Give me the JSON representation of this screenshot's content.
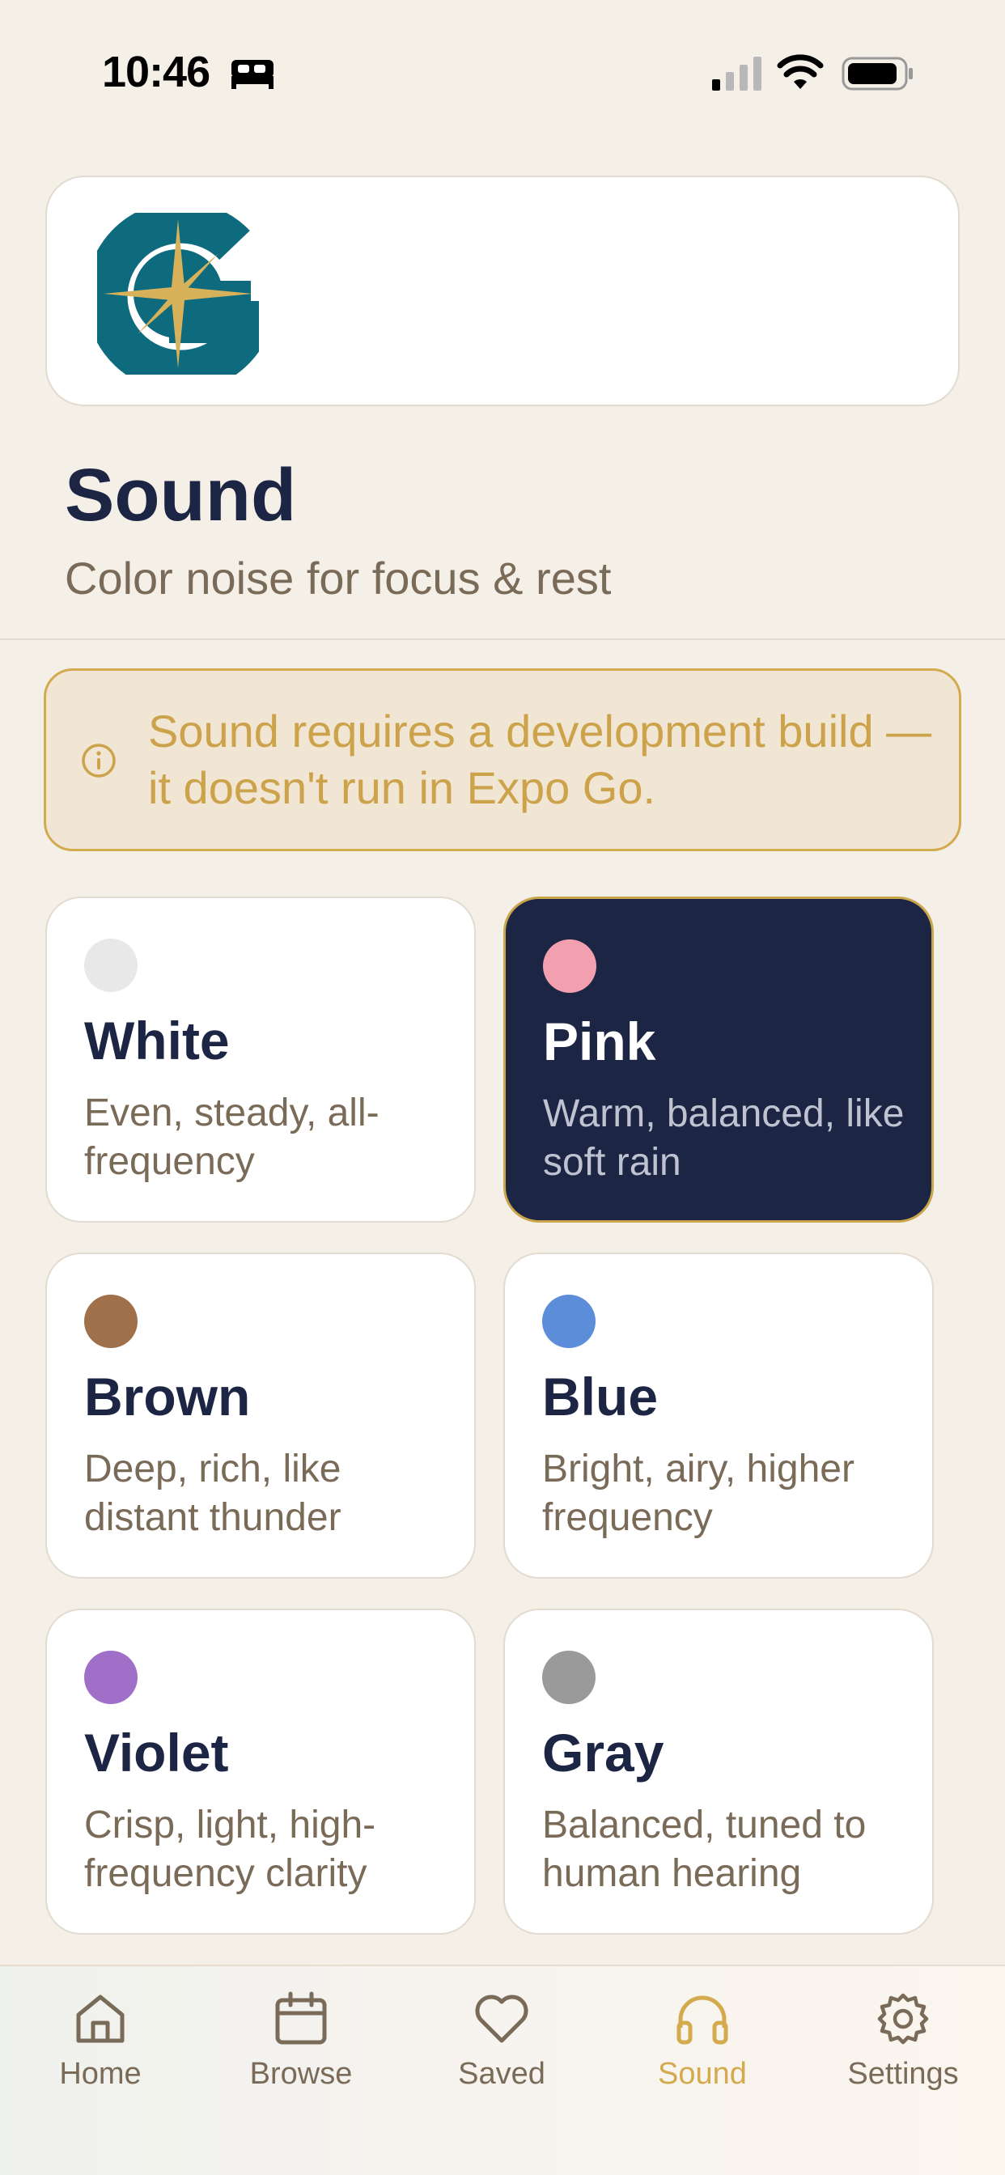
{
  "status_bar": {
    "time": "10:46"
  },
  "header": {
    "title": "Sound",
    "subtitle": "Color noise for focus & rest"
  },
  "notice": {
    "text": "Sound requires a development build — it doesn't run in Expo Go.",
    "icon": "info-icon"
  },
  "noise_options": [
    {
      "name": "White",
      "description": "Even, steady, all-frequency",
      "color": "#E8E8E8",
      "selected": false
    },
    {
      "name": "Pink",
      "description": "Warm, balanced, like soft rain",
      "color": "#F2A0B0",
      "selected": true
    },
    {
      "name": "Brown",
      "description": "Deep, rich, like distant thunder",
      "color": "#A0704A",
      "selected": false
    },
    {
      "name": "Blue",
      "description": "Bright, airy, higher frequency",
      "color": "#5B8DD9",
      "selected": false
    },
    {
      "name": "Violet",
      "description": "Crisp, light, high-frequency clarity",
      "color": "#A070C8",
      "selected": false
    },
    {
      "name": "Gray",
      "description": "Balanced, tuned to human hearing",
      "color": "#9A9A9A",
      "selected": false
    }
  ],
  "tabs": [
    {
      "label": "Home",
      "icon": "home-icon",
      "active": false
    },
    {
      "label": "Browse",
      "icon": "calendar-icon",
      "active": false
    },
    {
      "label": "Saved",
      "icon": "heart-icon",
      "active": false
    },
    {
      "label": "Sound",
      "icon": "headphones-icon",
      "active": true
    },
    {
      "label": "Settings",
      "icon": "gear-icon",
      "active": false
    }
  ],
  "colors": {
    "background": "#F4EFE7",
    "navy": "#1C2543",
    "gold": "#D4AA4E",
    "teal": "#0E6B7E",
    "muted": "#7A6B58"
  }
}
